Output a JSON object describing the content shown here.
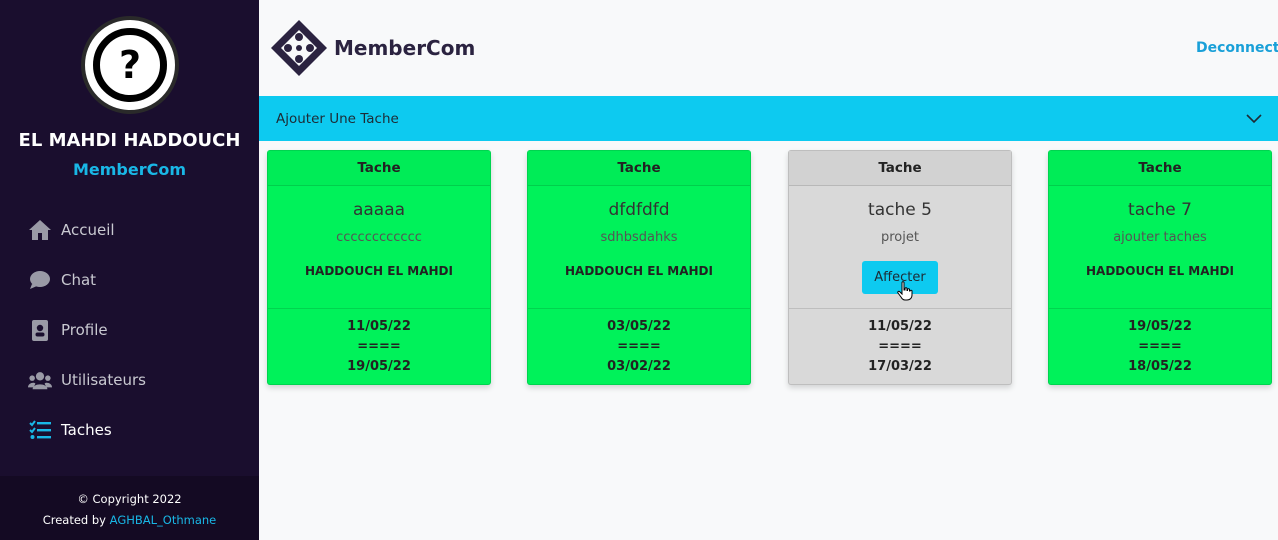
{
  "sidebar": {
    "avatar_icon": "question-mark-icon",
    "avatar_glyph": "?",
    "user_name": "EL MAHDI HADDOUCH",
    "brand": "MemberCom",
    "items": [
      {
        "label": "Accueil",
        "icon": "home-icon"
      },
      {
        "label": "Chat",
        "icon": "chat-icon"
      },
      {
        "label": "Profile",
        "icon": "id-badge-icon"
      },
      {
        "label": "Utilisateurs",
        "icon": "users-icon"
      },
      {
        "label": "Taches",
        "icon": "tasks-icon",
        "active": true
      }
    ],
    "footer": {
      "copyright": "© Copyright 2022",
      "created_by": "Created by",
      "author": "AGHBAL_Othmane"
    }
  },
  "header": {
    "logo_text": "MemberCom",
    "logout_label": "Deconnecte"
  },
  "accordion": {
    "label": "Ajouter Une Tache",
    "icon": "chevron-down-icon"
  },
  "tasks": [
    {
      "header": "Tache",
      "title": "aaaaa",
      "description": "cccccccccccc",
      "owner": "HADDOUCH EL MAHDI",
      "start": "11/05/22",
      "sep": "====",
      "end": "19/05/22",
      "status": "assigned"
    },
    {
      "header": "Tache",
      "title": "dfdfdfd",
      "description": "sdhbsdahks",
      "owner": "HADDOUCH EL MAHDI",
      "start": "03/05/22",
      "sep": "====",
      "end": "03/02/22",
      "status": "assigned"
    },
    {
      "header": "Tache",
      "title": "tache 5",
      "description": "projet",
      "button": "Affecter",
      "start": "11/05/22",
      "sep": "====",
      "end": "17/03/22",
      "status": "unassigned"
    },
    {
      "header": "Tache",
      "title": "tache 7",
      "description": "ajouter taches",
      "owner": "HADDOUCH EL MAHDI",
      "start": "19/05/22",
      "sep": "====",
      "end": "18/05/22",
      "status": "assigned"
    }
  ],
  "colors": {
    "sidebar_bg": "#1a0e2e",
    "accent": "#0dcaf0",
    "assigned_card": "#00f25a",
    "unassigned_card": "#d9d9d9"
  }
}
